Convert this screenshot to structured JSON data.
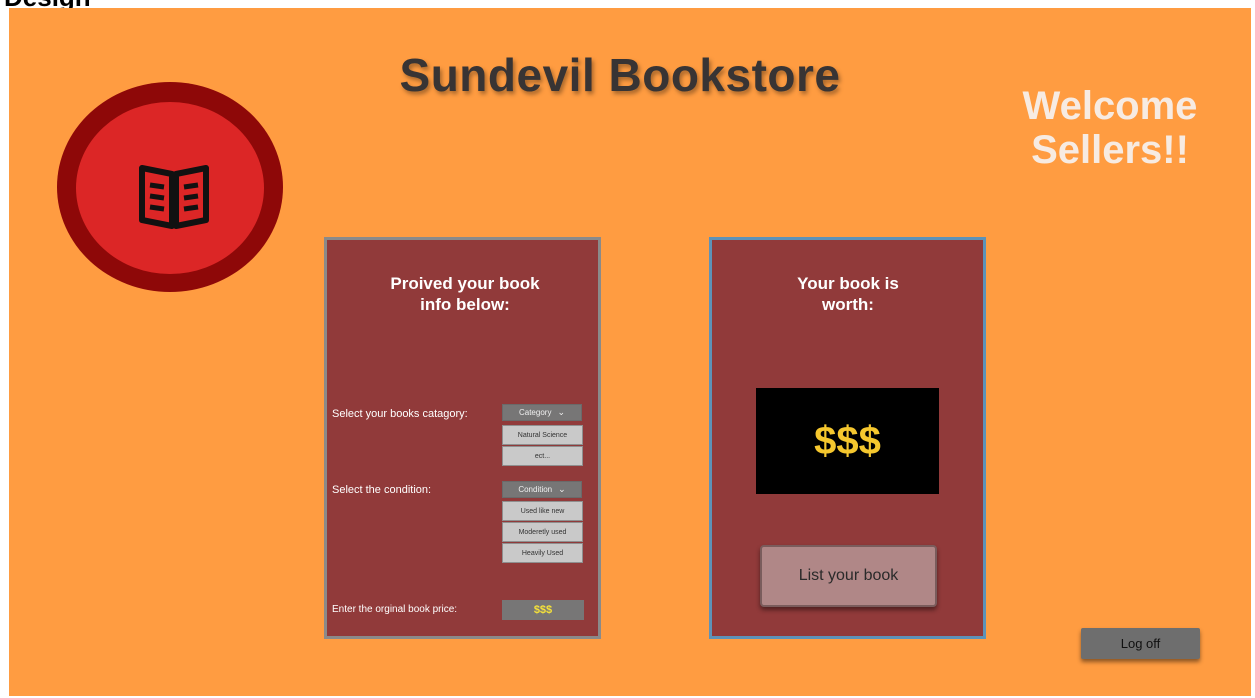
{
  "page": {
    "label": "Design"
  },
  "header": {
    "store_title": "Sundevil Bookstore",
    "welcome": "Welcome Sellers!!"
  },
  "logo": {
    "icon": "open-book-icon"
  },
  "form_panel": {
    "heading": "Proived your book info below:",
    "category_label": "Select your books catagory:",
    "category_dropdown": {
      "selected": "Category",
      "options": [
        "Natural Science",
        "ect..."
      ]
    },
    "condition_label": "Select the condition:",
    "condition_dropdown": {
      "selected": "Condition",
      "options": [
        "Used like new",
        "Moderetly used",
        "Heavily Used"
      ]
    },
    "price_label": "Enter the orginal book price:",
    "price_value": "$$$"
  },
  "result_panel": {
    "heading": "Your book is worth:",
    "worth_value": "$$$",
    "list_button": "List your book"
  },
  "footer": {
    "logoff_button": "Log off"
  },
  "colors": {
    "background": "#ff9c41",
    "panel": "#913a3a",
    "logo_outer": "#8e0808",
    "logo_inner": "#dc2626",
    "price_text": "#f5c72e"
  }
}
